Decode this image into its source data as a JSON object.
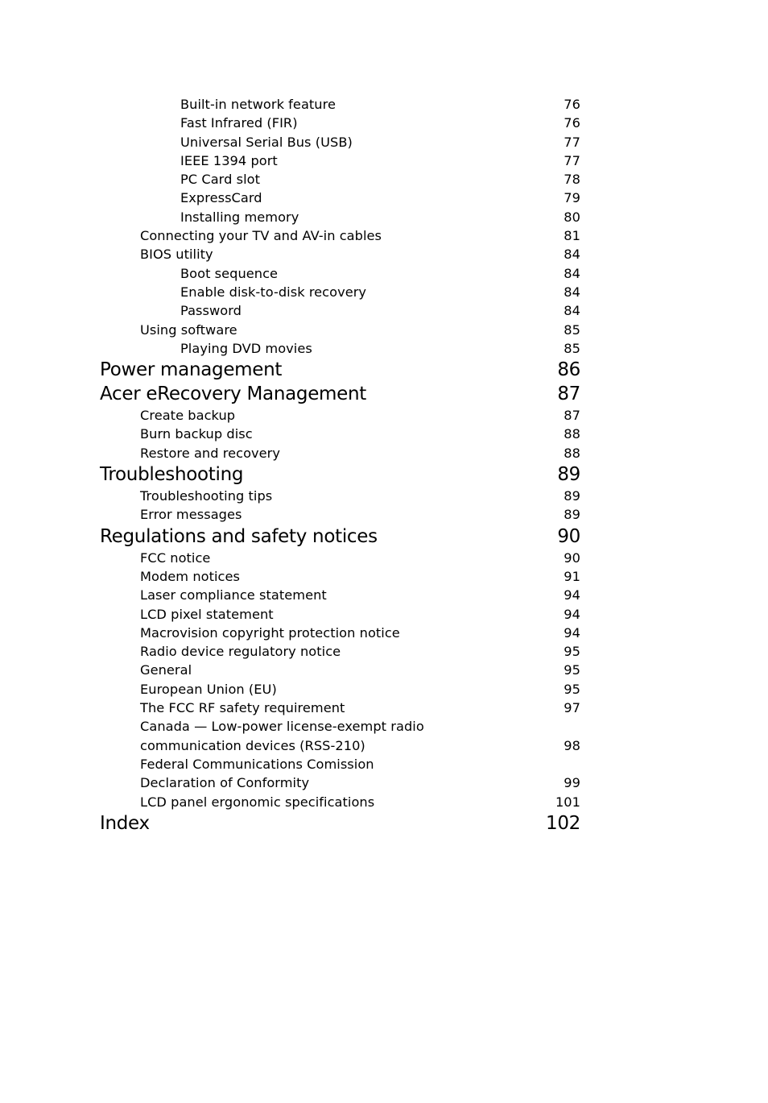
{
  "toc": {
    "entries": [
      {
        "level": 3,
        "title": "Built-in network feature",
        "page": "76"
      },
      {
        "level": 3,
        "title": "Fast Infrared (FIR)",
        "page": "76"
      },
      {
        "level": 3,
        "title": "Universal Serial Bus (USB)",
        "page": "77"
      },
      {
        "level": 3,
        "title": "IEEE 1394 port",
        "page": "77"
      },
      {
        "level": 3,
        "title": "PC Card slot",
        "page": "78"
      },
      {
        "level": 3,
        "title": "ExpressCard",
        "page": "79"
      },
      {
        "level": 3,
        "title": "Installing memory",
        "page": "80"
      },
      {
        "level": 2,
        "title": "Connecting your TV and AV-in cables",
        "page": "81"
      },
      {
        "level": 2,
        "title": "BIOS utility",
        "page": "84"
      },
      {
        "level": 3,
        "title": "Boot sequence",
        "page": "84"
      },
      {
        "level": 3,
        "title": "Enable disk-to-disk recovery",
        "page": "84"
      },
      {
        "level": 3,
        "title": "Password",
        "page": "84"
      },
      {
        "level": 2,
        "title": "Using software",
        "page": "85"
      },
      {
        "level": 3,
        "title": "Playing DVD movies",
        "page": "85"
      },
      {
        "level": 1,
        "title": "Power management",
        "page": "86"
      },
      {
        "level": 1,
        "title": "Acer eRecovery Management",
        "page": "87"
      },
      {
        "level": 2,
        "title": "Create backup",
        "page": "87"
      },
      {
        "level": 2,
        "title": "Burn backup disc",
        "page": "88"
      },
      {
        "level": 2,
        "title": "Restore and recovery",
        "page": "88"
      },
      {
        "level": 1,
        "title": "Troubleshooting",
        "page": "89"
      },
      {
        "level": 2,
        "title": "Troubleshooting tips",
        "page": "89"
      },
      {
        "level": 2,
        "title": "Error messages",
        "page": "89"
      },
      {
        "level": 1,
        "title": "Regulations and safety notices",
        "page": "90"
      },
      {
        "level": 2,
        "title": "FCC notice",
        "page": "90"
      },
      {
        "level": 2,
        "title": "Modem notices",
        "page": "91"
      },
      {
        "level": 2,
        "title": "Laser compliance statement",
        "page": "94"
      },
      {
        "level": 2,
        "title": "LCD pixel statement",
        "page": "94"
      },
      {
        "level": 2,
        "title": "Macrovision copyright protection notice",
        "page": "94"
      },
      {
        "level": 2,
        "title": "Radio device regulatory notice",
        "page": "95"
      },
      {
        "level": 2,
        "title": "General",
        "page": "95"
      },
      {
        "level": 2,
        "title": "European Union (EU)",
        "page": "95"
      },
      {
        "level": 2,
        "title": "The FCC RF safety requirement",
        "page": "97"
      },
      {
        "level": 2,
        "title": "Canada — Low-power license-exempt radio",
        "page": ""
      },
      {
        "level": 2,
        "title": "communication devices (RSS-210)",
        "page": "98"
      },
      {
        "level": 2,
        "title": "Federal Communications Comission",
        "page": ""
      },
      {
        "level": 2,
        "title": "Declaration of Conformity",
        "page": "99"
      },
      {
        "level": 2,
        "title": "LCD panel ergonomic specifications",
        "page": "101"
      },
      {
        "level": 1,
        "title": "Index",
        "page": "102"
      }
    ]
  }
}
